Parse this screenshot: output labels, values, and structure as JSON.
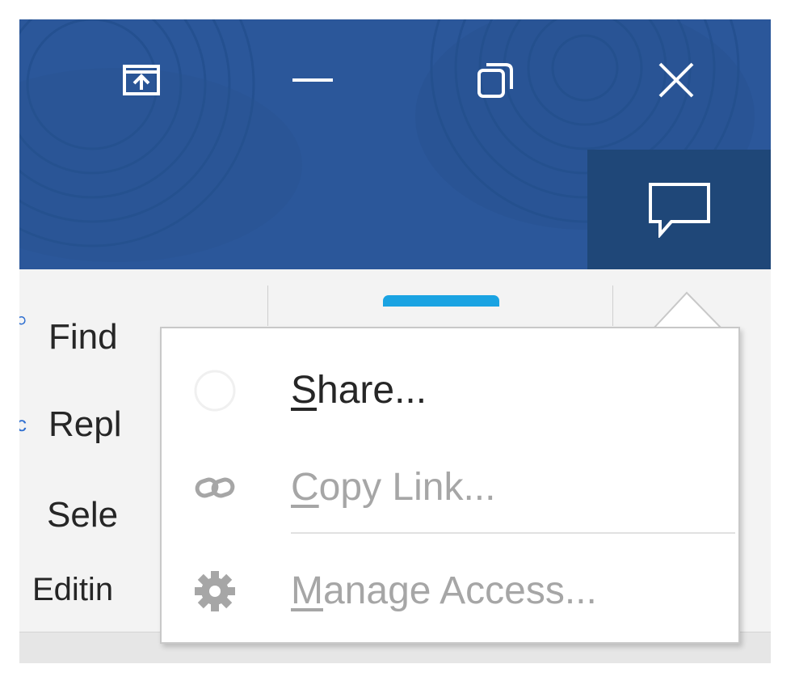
{
  "window": {
    "controls": [
      {
        "name": "ribbon-display-options-icon"
      },
      {
        "name": "minimize-icon"
      },
      {
        "name": "restore-icon"
      },
      {
        "name": "close-icon"
      }
    ],
    "comments_icon": "comment-bubble-icon"
  },
  "colors": {
    "titlebar": "#2b579a",
    "comments_button": "#1f4778",
    "accent_swatch": "#1aa3e2",
    "disabled_text": "#a6a6a6"
  },
  "ribbon": {
    "editing": {
      "find": "Find",
      "replace": "Repl",
      "select": "Sele",
      "group_label": "Editin"
    }
  },
  "share_menu": {
    "items": [
      {
        "label_underlined": "S",
        "label_rest": "hare...",
        "enabled": true,
        "icon": "share-icon"
      },
      {
        "label_underlined": "C",
        "label_rest": "opy Link...",
        "enabled": false,
        "icon": "link-icon"
      },
      {
        "label_underlined": "M",
        "label_rest": "anage Access...",
        "enabled": false,
        "icon": "gear-icon"
      }
    ]
  }
}
